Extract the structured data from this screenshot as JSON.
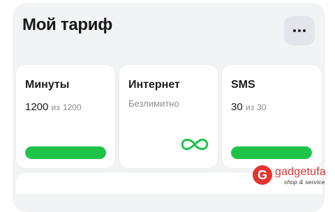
{
  "header": {
    "title": "Мой тариф",
    "menu_icon": "more-horizontal-icon"
  },
  "cards": {
    "minutes": {
      "label": "Минуты",
      "current": "1200",
      "of_text": "из",
      "total": "1200",
      "progress": 1.0
    },
    "internet": {
      "label": "Интернет",
      "status": "Безлимитно",
      "icon": "infinity-icon"
    },
    "sms": {
      "label": "SMS",
      "current": "30",
      "of_text": "из",
      "total": "30",
      "progress": 1.0
    }
  },
  "watermark": {
    "logo_letter": "G",
    "brand": "gadgetufa",
    "tagline": "shop & service"
  },
  "colors": {
    "accent": "#1ec449",
    "panel_bg": "#f2f3f5",
    "brand_red": "#e3342f"
  }
}
